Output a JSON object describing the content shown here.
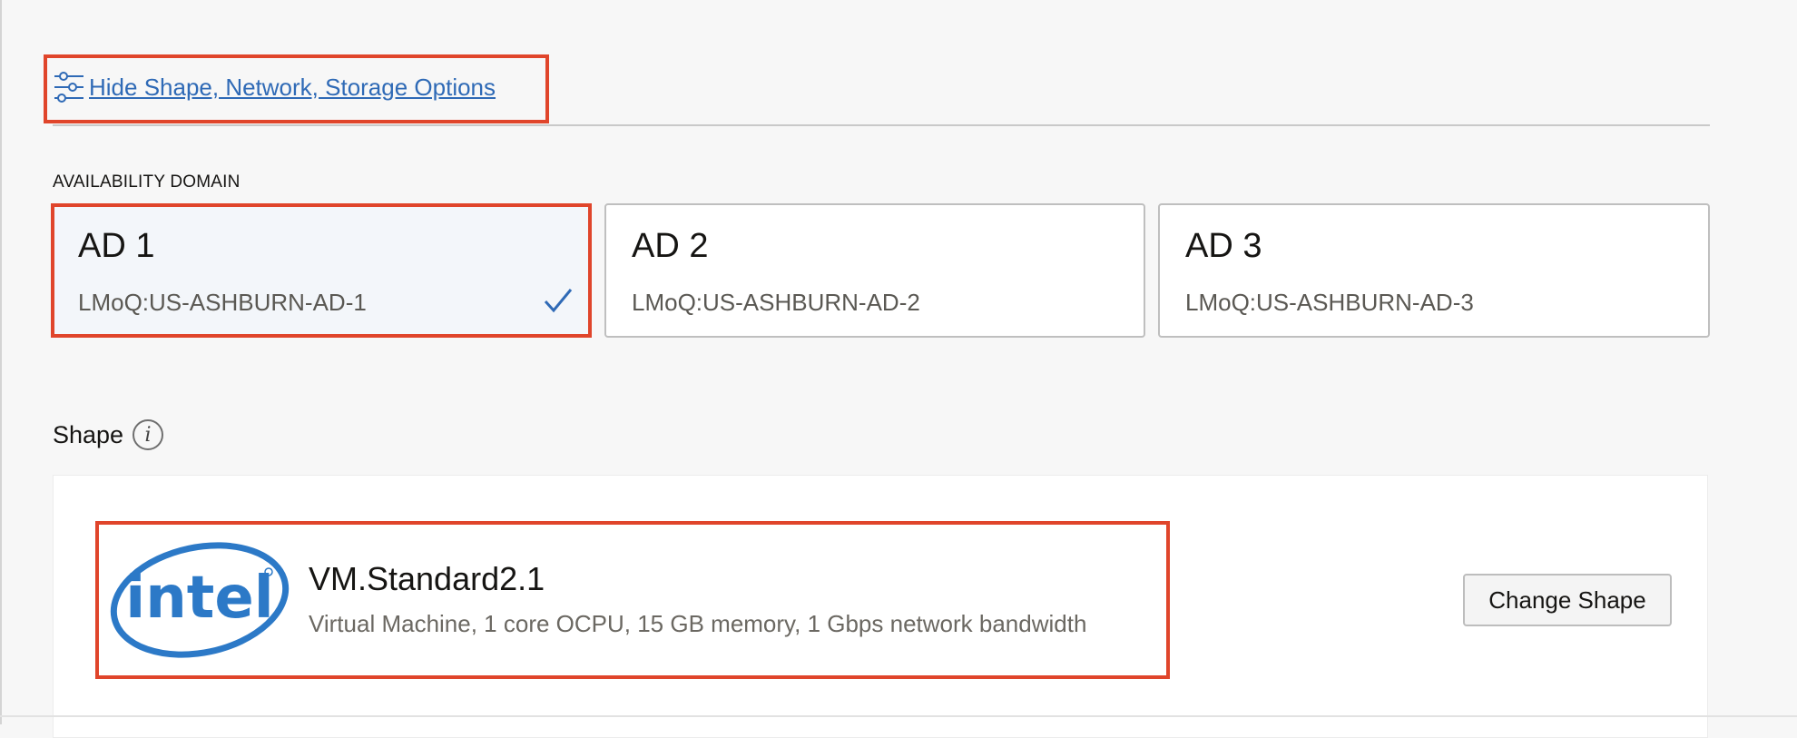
{
  "options_toggle": {
    "label": "Hide Shape, Network, Storage Options",
    "icon": "sliders-icon"
  },
  "availability_domain": {
    "label": "AVAILABILITY DOMAIN",
    "cards": [
      {
        "title": "AD 1",
        "subtitle": "LMoQ:US-ASHBURN-AD-1",
        "selected": true
      },
      {
        "title": "AD 2",
        "subtitle": "LMoQ:US-ASHBURN-AD-2",
        "selected": false
      },
      {
        "title": "AD 3",
        "subtitle": "LMoQ:US-ASHBURN-AD-3",
        "selected": false
      }
    ]
  },
  "shape": {
    "label": "Shape",
    "name": "VM.Standard2.1",
    "description": "Virtual Machine, 1 core OCPU, 15 GB memory, 1 Gbps network bandwidth",
    "logo_text": "intel",
    "change_button": "Change Shape"
  },
  "colors": {
    "link": "#2f6ab6",
    "highlight": "#e0452b",
    "intel_blue": "#2c79c7"
  }
}
